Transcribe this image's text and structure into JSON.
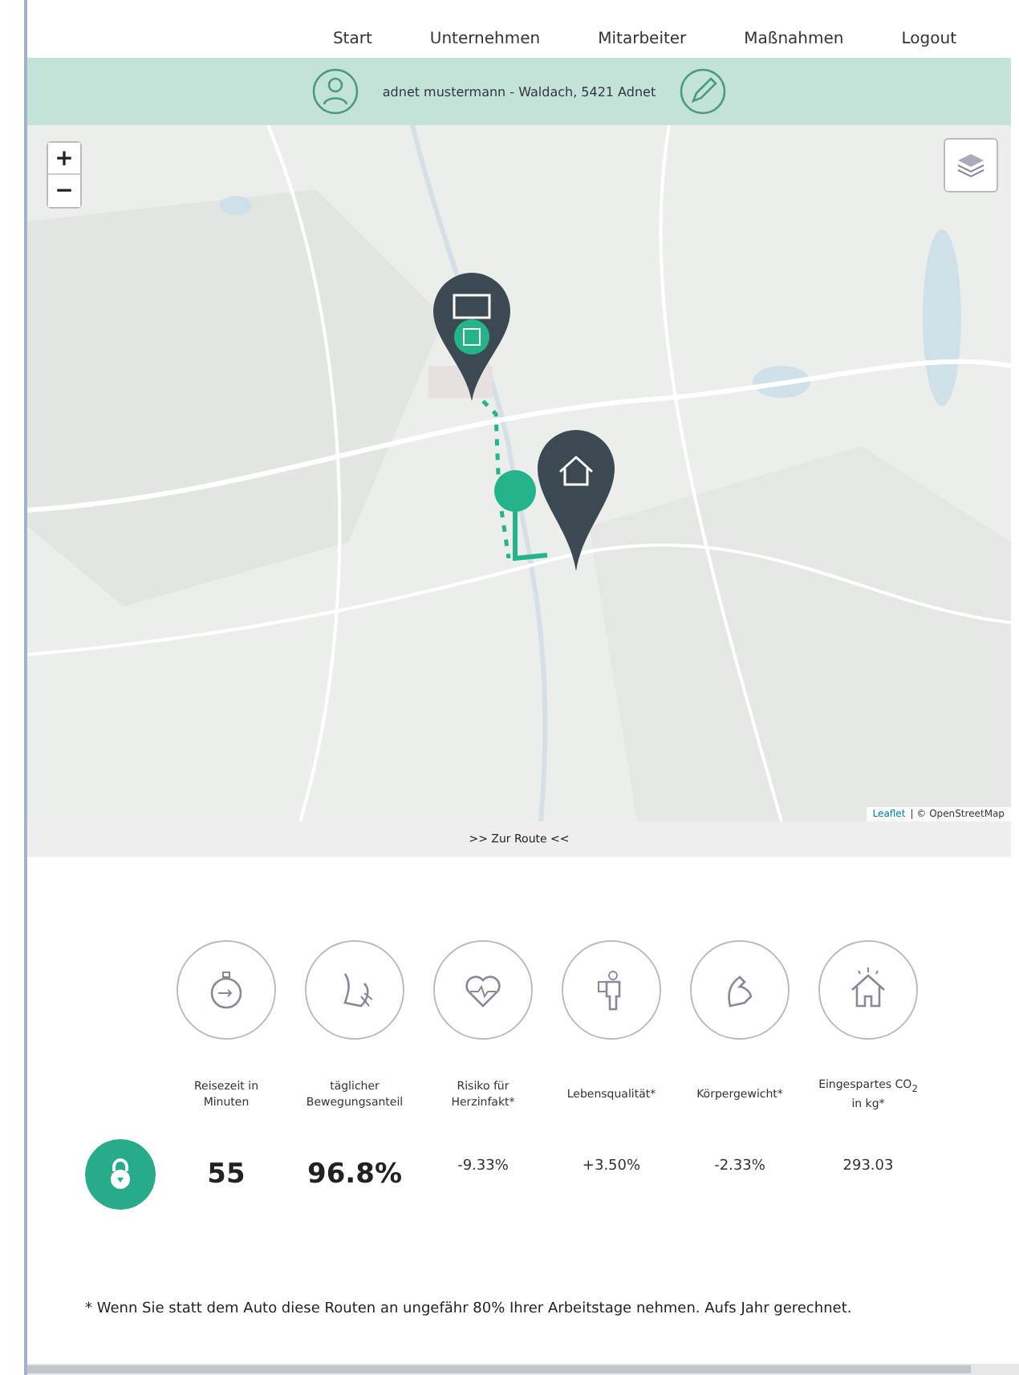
{
  "nav": [
    {
      "label": "Start"
    },
    {
      "label": "Unternehmen"
    },
    {
      "label": "Mitarbeiter"
    },
    {
      "label": "Maßnahmen"
    },
    {
      "label": "Logout"
    }
  ],
  "user_bar": {
    "text": "adnet mustermann - Waldach, 5421 Adnet"
  },
  "map": {
    "zoom_in": "+",
    "zoom_out": "−",
    "attribution_link": "Leaflet",
    "attribution_rest": "| © OpenStreetMap"
  },
  "route_link": ">> Zur Route <<",
  "metrics": [
    {
      "label": "Reisezeit in Minuten",
      "value": "55",
      "emphasis": true
    },
    {
      "label": "täglicher Bewegungsanteil",
      "value": "96.8%",
      "emphasis": true
    },
    {
      "label": "Risiko für Herzinfakt*",
      "value": "-9.33%",
      "emphasis": false
    },
    {
      "label": "Lebensqualität*",
      "value": "+3.50%",
      "emphasis": false
    },
    {
      "label": "Körpergewicht*",
      "value": "-2.33%",
      "emphasis": false
    },
    {
      "label": "Eingespartes CO$_{2}$ in kg*",
      "value": "293.03",
      "emphasis": false
    }
  ],
  "footnote": "* Wenn Sie statt dem Auto diese Routen an ungefähr 80% Ihrer Arbeitstage nehmen. Aufs Jahr gerechnet."
}
